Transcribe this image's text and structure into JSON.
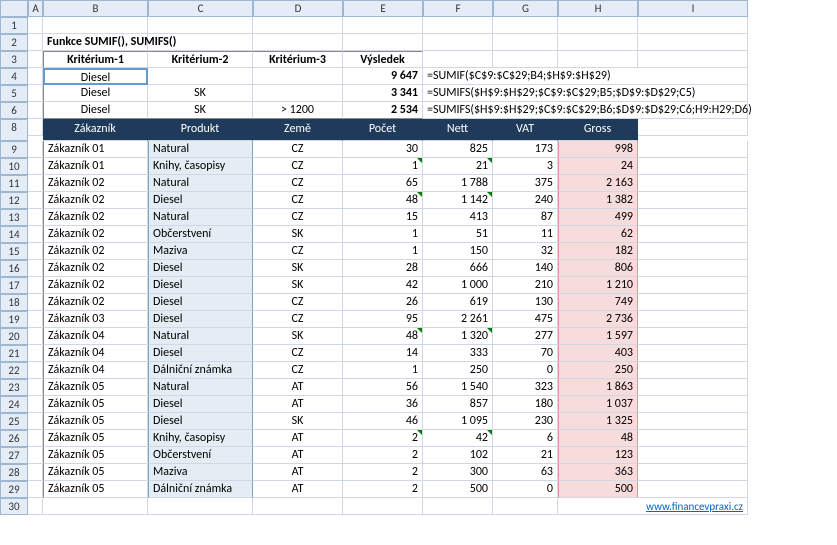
{
  "columns": [
    "A",
    "B",
    "C",
    "D",
    "E",
    "F",
    "G",
    "H",
    "I"
  ],
  "rows": [
    "1",
    "2",
    "3",
    "4",
    "5",
    "6",
    "8",
    "9",
    "10",
    "11",
    "12",
    "13",
    "14",
    "15",
    "16",
    "17",
    "18",
    "19",
    "20",
    "21",
    "22",
    "23",
    "24",
    "25",
    "26",
    "27",
    "28",
    "29",
    "30"
  ],
  "title": "Funkce SUMIF(), SUMIFS()",
  "krit_headers": [
    "Kritérium-1",
    "Kritérium-2",
    "Kritérium-3",
    "Výsledek"
  ],
  "krit_rows": [
    {
      "k1": "Diesel",
      "k2": "",
      "k3": "",
      "res": "9 647",
      "formula": "=SUMIF($C$9:$C$29;B4;$H$9:$H$29)"
    },
    {
      "k1": "Diesel",
      "k2": "SK",
      "k3": "",
      "res": "3 341",
      "formula": "=SUMIFS($H$9:$H$29;$C$9:$C$29;B5;$D$9:$D$29;C5)"
    },
    {
      "k1": "Diesel",
      "k2": "SK",
      "k3": "> 1200",
      "res": "2 534",
      "formula": "=SUMIFS($H$9:$H$29;$C$9:$C$29;B6;$D$9:$D$29;C6;H9:H29;D6)"
    }
  ],
  "table_headers": [
    "Zákazník",
    "Produkt",
    "Země",
    "Počet",
    "Nett",
    "VAT",
    "Gross"
  ],
  "data": [
    {
      "zak": "Zákazník 01",
      "prod": "Natural",
      "zeme": "CZ",
      "pocet": "30",
      "nett": "825",
      "vat": "173",
      "gross": "998",
      "tri": false
    },
    {
      "zak": "Zákazník 01",
      "prod": "Knihy, časopisy",
      "zeme": "CZ",
      "pocet": "1",
      "nett": "21",
      "vat": "3",
      "gross": "24",
      "tri": true
    },
    {
      "zak": "Zákazník 02",
      "prod": "Natural",
      "zeme": "CZ",
      "pocet": "65",
      "nett": "1 788",
      "vat": "375",
      "gross": "2 163",
      "tri": false
    },
    {
      "zak": "Zákazník 02",
      "prod": "Diesel",
      "zeme": "CZ",
      "pocet": "48",
      "nett": "1 142",
      "vat": "240",
      "gross": "1 382",
      "tri": true
    },
    {
      "zak": "Zákazník 02",
      "prod": "Natural",
      "zeme": "CZ",
      "pocet": "15",
      "nett": "413",
      "vat": "87",
      "gross": "499",
      "tri": false
    },
    {
      "zak": "Zákazník 02",
      "prod": "Občerstvení",
      "zeme": "SK",
      "pocet": "1",
      "nett": "51",
      "vat": "11",
      "gross": "62",
      "tri": false
    },
    {
      "zak": "Zákazník 02",
      "prod": "Maziva",
      "zeme": "CZ",
      "pocet": "1",
      "nett": "150",
      "vat": "32",
      "gross": "182",
      "tri": false
    },
    {
      "zak": "Zákazník 02",
      "prod": "Diesel",
      "zeme": "SK",
      "pocet": "28",
      "nett": "666",
      "vat": "140",
      "gross": "806",
      "tri": false
    },
    {
      "zak": "Zákazník 02",
      "prod": "Diesel",
      "zeme": "SK",
      "pocet": "42",
      "nett": "1 000",
      "vat": "210",
      "gross": "1 210",
      "tri": false
    },
    {
      "zak": "Zákazník 02",
      "prod": "Diesel",
      "zeme": "CZ",
      "pocet": "26",
      "nett": "619",
      "vat": "130",
      "gross": "749",
      "tri": false
    },
    {
      "zak": "Zákazník 03",
      "prod": "Diesel",
      "zeme": "CZ",
      "pocet": "95",
      "nett": "2 261",
      "vat": "475",
      "gross": "2 736",
      "tri": false
    },
    {
      "zak": "Zákazník 04",
      "prod": "Natural",
      "zeme": "SK",
      "pocet": "48",
      "nett": "1 320",
      "vat": "277",
      "gross": "1 597",
      "tri": true
    },
    {
      "zak": "Zákazník 04",
      "prod": "Diesel",
      "zeme": "CZ",
      "pocet": "14",
      "nett": "333",
      "vat": "70",
      "gross": "403",
      "tri": false
    },
    {
      "zak": "Zákazník 04",
      "prod": "Dálniční známka",
      "zeme": "CZ",
      "pocet": "1",
      "nett": "250",
      "vat": "0",
      "gross": "250",
      "tri": false
    },
    {
      "zak": "Zákazník 05",
      "prod": "Natural",
      "zeme": "AT",
      "pocet": "56",
      "nett": "1 540",
      "vat": "323",
      "gross": "1 863",
      "tri": false
    },
    {
      "zak": "Zákazník 05",
      "prod": "Diesel",
      "zeme": "AT",
      "pocet": "36",
      "nett": "857",
      "vat": "180",
      "gross": "1 037",
      "tri": false
    },
    {
      "zak": "Zákazník 05",
      "prod": "Diesel",
      "zeme": "SK",
      "pocet": "46",
      "nett": "1 095",
      "vat": "230",
      "gross": "1 325",
      "tri": false
    },
    {
      "zak": "Zákazník 05",
      "prod": "Knihy, časopisy",
      "zeme": "AT",
      "pocet": "2",
      "nett": "42",
      "vat": "6",
      "gross": "48",
      "tri": true
    },
    {
      "zak": "Zákazník 05",
      "prod": "Občerstvení",
      "zeme": "AT",
      "pocet": "2",
      "nett": "102",
      "vat": "21",
      "gross": "123",
      "tri": false
    },
    {
      "zak": "Zákazník 05",
      "prod": "Maziva",
      "zeme": "AT",
      "pocet": "2",
      "nett": "300",
      "vat": "63",
      "gross": "363",
      "tri": false
    },
    {
      "zak": "Zákazník 05",
      "prod": "Dálniční známka",
      "zeme": "AT",
      "pocet": "2",
      "nett": "500",
      "vat": "0",
      "gross": "500",
      "tri": false
    }
  ],
  "footer_link": "www.financevpraxi.cz"
}
